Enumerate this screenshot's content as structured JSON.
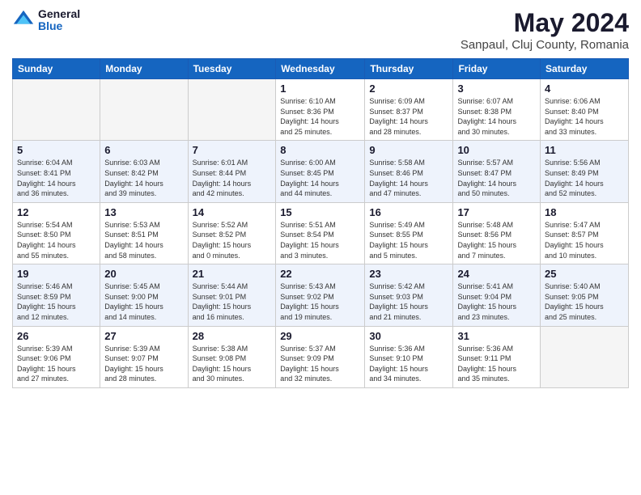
{
  "logo": {
    "general": "General",
    "blue": "Blue"
  },
  "title": "May 2024",
  "subtitle": "Sanpaul, Cluj County, Romania",
  "days_of_week": [
    "Sunday",
    "Monday",
    "Tuesday",
    "Wednesday",
    "Thursday",
    "Friday",
    "Saturday"
  ],
  "weeks": [
    [
      {
        "day": "",
        "info": ""
      },
      {
        "day": "",
        "info": ""
      },
      {
        "day": "",
        "info": ""
      },
      {
        "day": "1",
        "info": "Sunrise: 6:10 AM\nSunset: 8:36 PM\nDaylight: 14 hours\nand 25 minutes."
      },
      {
        "day": "2",
        "info": "Sunrise: 6:09 AM\nSunset: 8:37 PM\nDaylight: 14 hours\nand 28 minutes."
      },
      {
        "day": "3",
        "info": "Sunrise: 6:07 AM\nSunset: 8:38 PM\nDaylight: 14 hours\nand 30 minutes."
      },
      {
        "day": "4",
        "info": "Sunrise: 6:06 AM\nSunset: 8:40 PM\nDaylight: 14 hours\nand 33 minutes."
      }
    ],
    [
      {
        "day": "5",
        "info": "Sunrise: 6:04 AM\nSunset: 8:41 PM\nDaylight: 14 hours\nand 36 minutes."
      },
      {
        "day": "6",
        "info": "Sunrise: 6:03 AM\nSunset: 8:42 PM\nDaylight: 14 hours\nand 39 minutes."
      },
      {
        "day": "7",
        "info": "Sunrise: 6:01 AM\nSunset: 8:44 PM\nDaylight: 14 hours\nand 42 minutes."
      },
      {
        "day": "8",
        "info": "Sunrise: 6:00 AM\nSunset: 8:45 PM\nDaylight: 14 hours\nand 44 minutes."
      },
      {
        "day": "9",
        "info": "Sunrise: 5:58 AM\nSunset: 8:46 PM\nDaylight: 14 hours\nand 47 minutes."
      },
      {
        "day": "10",
        "info": "Sunrise: 5:57 AM\nSunset: 8:47 PM\nDaylight: 14 hours\nand 50 minutes."
      },
      {
        "day": "11",
        "info": "Sunrise: 5:56 AM\nSunset: 8:49 PM\nDaylight: 14 hours\nand 52 minutes."
      }
    ],
    [
      {
        "day": "12",
        "info": "Sunrise: 5:54 AM\nSunset: 8:50 PM\nDaylight: 14 hours\nand 55 minutes."
      },
      {
        "day": "13",
        "info": "Sunrise: 5:53 AM\nSunset: 8:51 PM\nDaylight: 14 hours\nand 58 minutes."
      },
      {
        "day": "14",
        "info": "Sunrise: 5:52 AM\nSunset: 8:52 PM\nDaylight: 15 hours\nand 0 minutes."
      },
      {
        "day": "15",
        "info": "Sunrise: 5:51 AM\nSunset: 8:54 PM\nDaylight: 15 hours\nand 3 minutes."
      },
      {
        "day": "16",
        "info": "Sunrise: 5:49 AM\nSunset: 8:55 PM\nDaylight: 15 hours\nand 5 minutes."
      },
      {
        "day": "17",
        "info": "Sunrise: 5:48 AM\nSunset: 8:56 PM\nDaylight: 15 hours\nand 7 minutes."
      },
      {
        "day": "18",
        "info": "Sunrise: 5:47 AM\nSunset: 8:57 PM\nDaylight: 15 hours\nand 10 minutes."
      }
    ],
    [
      {
        "day": "19",
        "info": "Sunrise: 5:46 AM\nSunset: 8:59 PM\nDaylight: 15 hours\nand 12 minutes."
      },
      {
        "day": "20",
        "info": "Sunrise: 5:45 AM\nSunset: 9:00 PM\nDaylight: 15 hours\nand 14 minutes."
      },
      {
        "day": "21",
        "info": "Sunrise: 5:44 AM\nSunset: 9:01 PM\nDaylight: 15 hours\nand 16 minutes."
      },
      {
        "day": "22",
        "info": "Sunrise: 5:43 AM\nSunset: 9:02 PM\nDaylight: 15 hours\nand 19 minutes."
      },
      {
        "day": "23",
        "info": "Sunrise: 5:42 AM\nSunset: 9:03 PM\nDaylight: 15 hours\nand 21 minutes."
      },
      {
        "day": "24",
        "info": "Sunrise: 5:41 AM\nSunset: 9:04 PM\nDaylight: 15 hours\nand 23 minutes."
      },
      {
        "day": "25",
        "info": "Sunrise: 5:40 AM\nSunset: 9:05 PM\nDaylight: 15 hours\nand 25 minutes."
      }
    ],
    [
      {
        "day": "26",
        "info": "Sunrise: 5:39 AM\nSunset: 9:06 PM\nDaylight: 15 hours\nand 27 minutes."
      },
      {
        "day": "27",
        "info": "Sunrise: 5:39 AM\nSunset: 9:07 PM\nDaylight: 15 hours\nand 28 minutes."
      },
      {
        "day": "28",
        "info": "Sunrise: 5:38 AM\nSunset: 9:08 PM\nDaylight: 15 hours\nand 30 minutes."
      },
      {
        "day": "29",
        "info": "Sunrise: 5:37 AM\nSunset: 9:09 PM\nDaylight: 15 hours\nand 32 minutes."
      },
      {
        "day": "30",
        "info": "Sunrise: 5:36 AM\nSunset: 9:10 PM\nDaylight: 15 hours\nand 34 minutes."
      },
      {
        "day": "31",
        "info": "Sunrise: 5:36 AM\nSunset: 9:11 PM\nDaylight: 15 hours\nand 35 minutes."
      },
      {
        "day": "",
        "info": ""
      }
    ]
  ]
}
